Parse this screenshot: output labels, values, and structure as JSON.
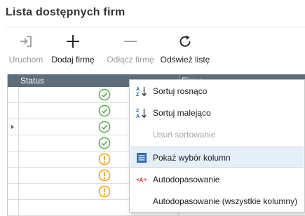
{
  "page": {
    "title": "Lista dostępnych firm"
  },
  "toolbar": {
    "start_label": "Uruchom",
    "add_label": "Dodaj firmę",
    "detach_label": "Odłącz firmę",
    "refresh_label": "Odśwież listę"
  },
  "grid": {
    "columns": [
      "Status",
      "Firma"
    ],
    "rows": [
      {
        "status": "ok",
        "icon": "check-circle-icon"
      },
      {
        "status": "ok",
        "icon": "check-circle-icon"
      },
      {
        "status": "ok",
        "icon": "check-circle-icon",
        "current": true
      },
      {
        "status": "ok",
        "icon": "check-circle-icon"
      },
      {
        "status": "warning",
        "icon": "exclamation-circle-icon"
      },
      {
        "status": "warning",
        "icon": "exclamation-circle-icon"
      },
      {
        "status": "warning",
        "icon": "exclamation-circle-icon"
      }
    ]
  },
  "context_menu": {
    "items": [
      {
        "label": "Sortuj rosnąco",
        "icon": "sort-ascending-icon",
        "enabled": true
      },
      {
        "label": "Sortuj malejąco",
        "icon": "sort-descending-icon",
        "enabled": true
      },
      {
        "label": "Usuń sortowanie",
        "icon": "",
        "enabled": false
      },
      {
        "label": "Pokaż wybór kolumn",
        "icon": "column-chooser-icon",
        "enabled": true,
        "highlighted": true
      },
      {
        "label": "Autodopasowanie",
        "icon": "autofit-icon",
        "enabled": true
      },
      {
        "label": "Autodopasowanie (wszystkie kolumny)",
        "icon": "",
        "enabled": true
      }
    ]
  },
  "colors": {
    "header_bg": "#5c6d7c",
    "ok_green": "#52b043",
    "warning_orange": "#f0a000",
    "menu_highlight": "#e6eef7",
    "toolbar_icon_disabled": "#a6a6a6"
  }
}
